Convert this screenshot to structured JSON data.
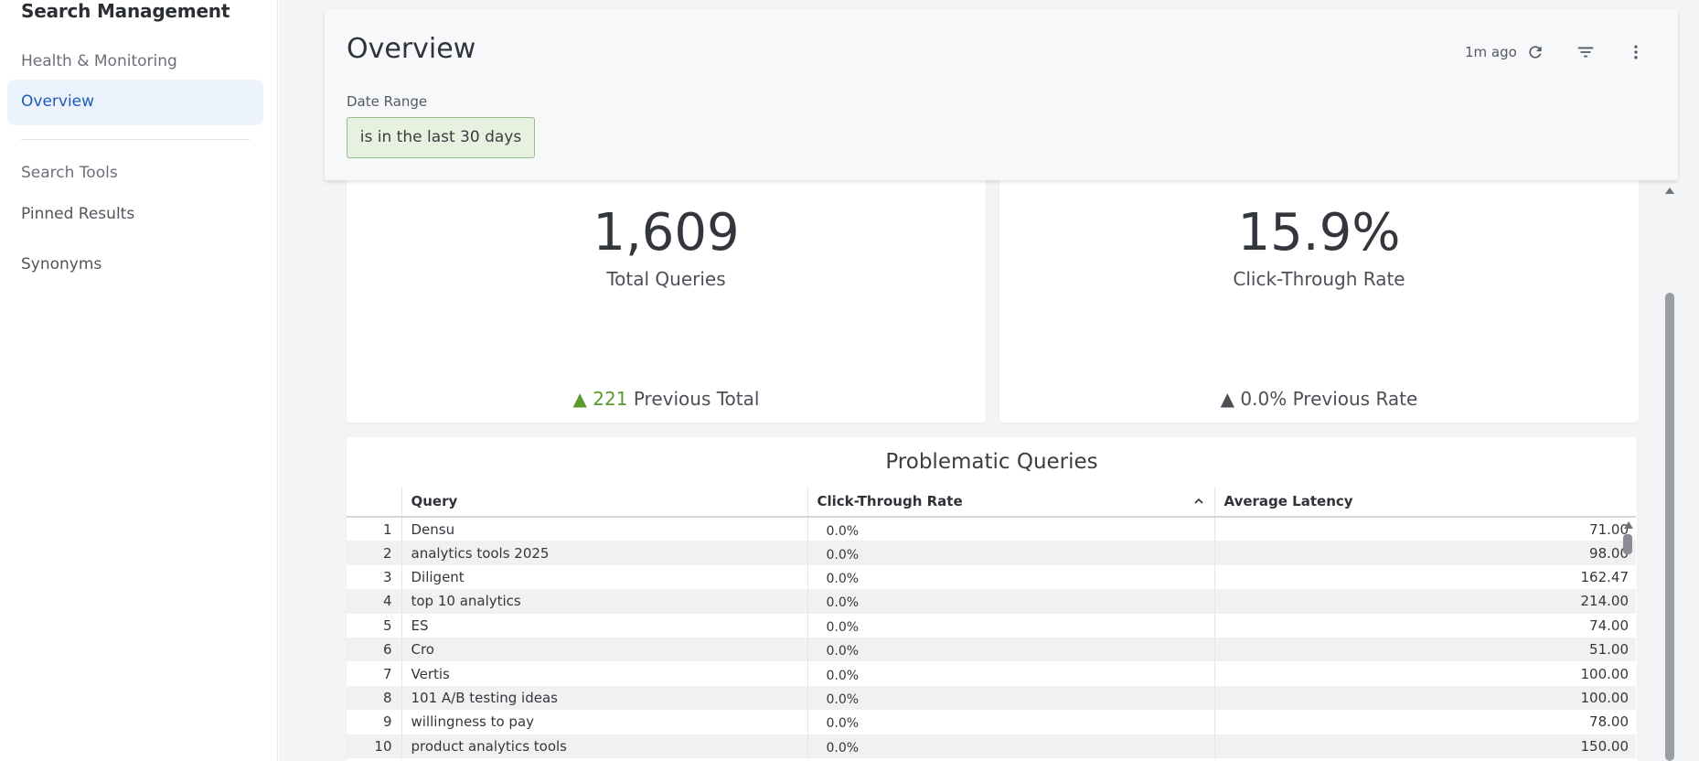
{
  "sidebar": {
    "title": "Search Management",
    "section1": "Health & Monitoring",
    "active_item": "Overview",
    "section2": "Search Tools",
    "items": [
      "Pinned Results",
      "Synonyms"
    ]
  },
  "header": {
    "title": "Overview",
    "refreshed": "1m ago",
    "date_range_label": "Date Range",
    "date_range_value": "is in the last 30 days"
  },
  "kpis": {
    "total_queries": {
      "value": "1,609",
      "label": "Total Queries",
      "delta_arrow": "▲",
      "delta": "221",
      "delta_label": "Previous Total"
    },
    "ctr": {
      "value": "15.9%",
      "label": "Click-Through Rate",
      "delta_arrow": "▲",
      "delta": "0.0%",
      "delta_label": "Previous Rate"
    }
  },
  "table": {
    "title": "Problematic Queries",
    "columns": [
      "Query",
      "Click-Through Rate",
      "Average Latency"
    ],
    "rows": [
      {
        "idx": "1",
        "query": "Densu",
        "ctr": "0.0%",
        "latency": "71.00"
      },
      {
        "idx": "2",
        "query": "analytics tools 2025",
        "ctr": "0.0%",
        "latency": "98.00"
      },
      {
        "idx": "3",
        "query": "Diligent",
        "ctr": "0.0%",
        "latency": "162.47"
      },
      {
        "idx": "4",
        "query": "top 10 analytics",
        "ctr": "0.0%",
        "latency": "214.00"
      },
      {
        "idx": "5",
        "query": "ES",
        "ctr": "0.0%",
        "latency": "74.00"
      },
      {
        "idx": "6",
        "query": "Cro",
        "ctr": "0.0%",
        "latency": "51.00"
      },
      {
        "idx": "7",
        "query": "Vertis",
        "ctr": "0.0%",
        "latency": "100.00"
      },
      {
        "idx": "8",
        "query": "101 A/B testing ideas",
        "ctr": "0.0%",
        "latency": "100.00"
      },
      {
        "idx": "9",
        "query": "willingness to pay",
        "ctr": "0.0%",
        "latency": "78.00"
      },
      {
        "idx": "10",
        "query": "product analytics tools",
        "ctr": "0.0%",
        "latency": "150.00"
      }
    ]
  },
  "icons": {
    "refresh": "refresh-icon",
    "filter": "filter-icon",
    "more": "more-vertical-icon",
    "sort": "chevron-up-icon"
  },
  "colors": {
    "accent": "#1d5bb8",
    "positive": "#5c9a2c",
    "chip_bg": "#e6f1df",
    "chip_border": "#9bbd8a"
  }
}
